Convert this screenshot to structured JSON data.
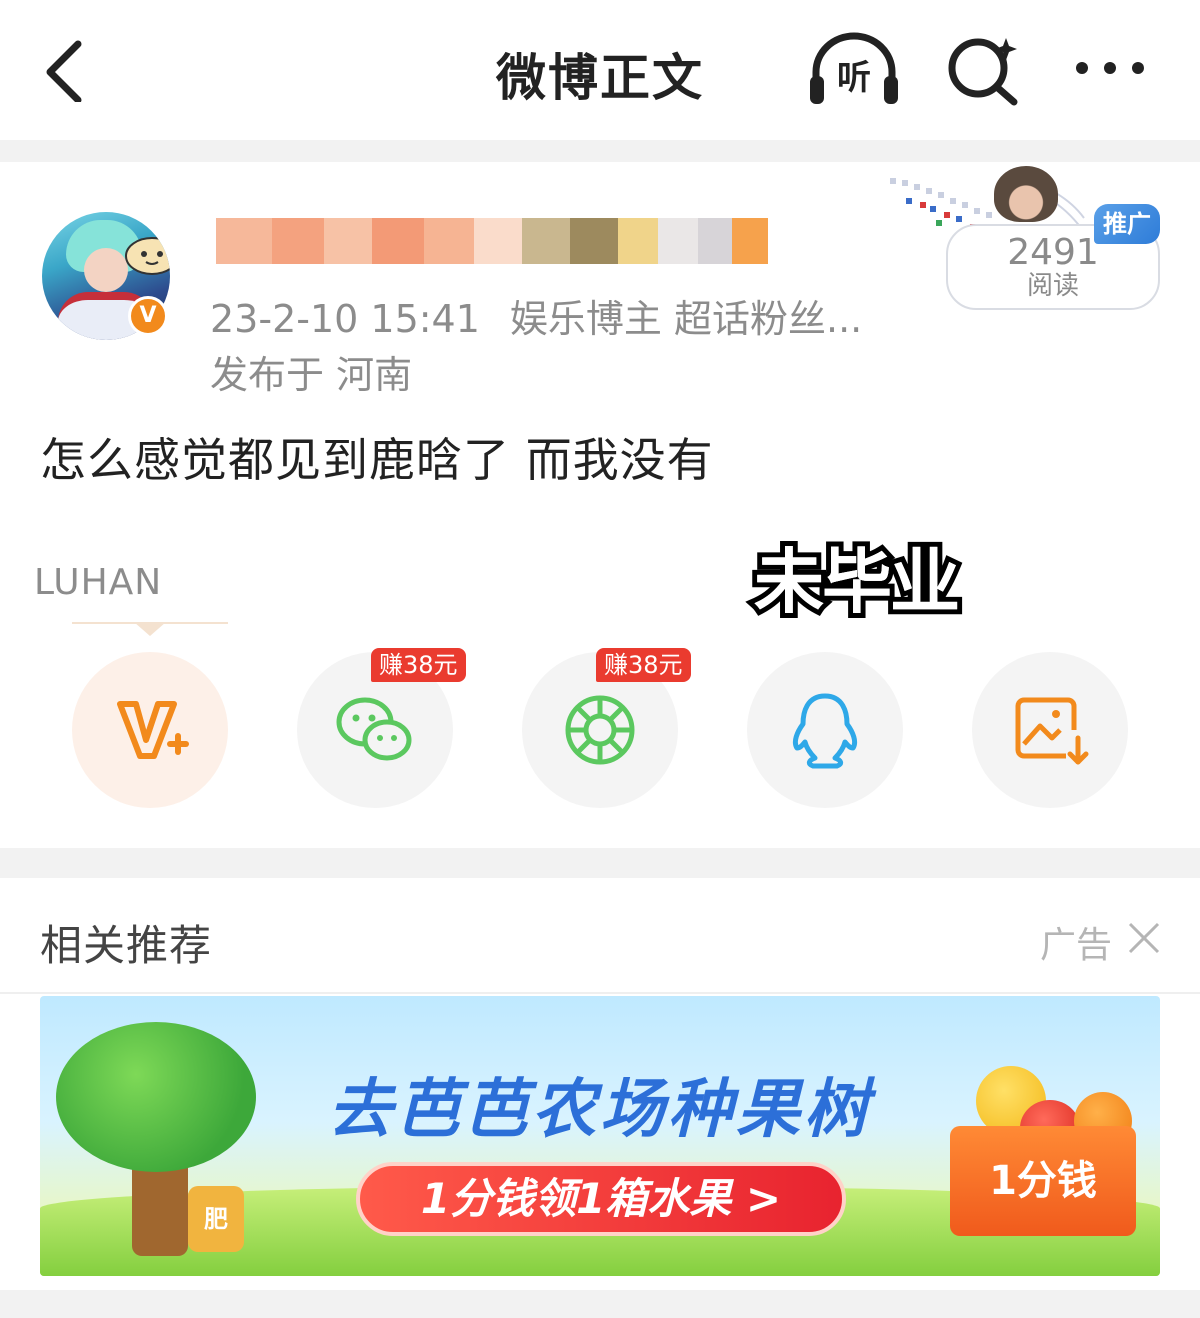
{
  "nav": {
    "title": "微博正文",
    "listen_label": "听",
    "icons": [
      "back-arrow-icon",
      "headphones-icon",
      "search-sparkle-icon",
      "more-dots-icon"
    ]
  },
  "post": {
    "meta_time": "23-2-10 15:41",
    "meta_tags": "娱乐博主 超话粉丝...",
    "location": "发布于 河南",
    "body_text": "怎么感觉都见到鹿晗了 而我没有",
    "verified_badge": "V",
    "promo_tag": "推广",
    "read_count": "2491",
    "read_label": "阅读",
    "watermark": "LUHAN",
    "sticker_text": "未毕业"
  },
  "share": {
    "items": [
      {
        "name": "vplus",
        "icon": "v-plus-icon",
        "badge": ""
      },
      {
        "name": "wechat",
        "icon": "wechat-icon",
        "badge": "赚38元"
      },
      {
        "name": "moments",
        "icon": "moments-shutter-icon",
        "badge": "赚38元"
      },
      {
        "name": "qq",
        "icon": "qq-penguin-icon",
        "badge": ""
      },
      {
        "name": "save-image",
        "icon": "image-download-icon",
        "badge": ""
      }
    ]
  },
  "recommend": {
    "title": "相关推荐",
    "ad_label": "广告",
    "banner_headline": "去芭芭农场种果树",
    "banner_button": "1分钱领1箱水果 >",
    "banner_box": "1分钱",
    "banner_pot": "肥"
  },
  "colors": {
    "accent_orange": "#f28a1c",
    "wechat_green": "#5bc85f",
    "qq_blue": "#2ea8e8",
    "badge_red": "#ea3b2f",
    "text_gray": "#8c8c8c"
  }
}
